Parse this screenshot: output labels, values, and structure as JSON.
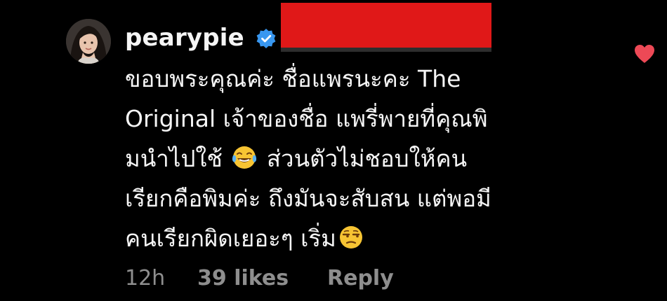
{
  "comment": {
    "username": "pearypie",
    "verified": true,
    "text_lines": [
      "ขอบพระคุณค่ะ ชื่อแพรนะคะ The",
      "Original เจ้าของชื่อ แพรี่พายที่คุณพิ",
      "มนำไปใช้",
      "ส่วนตัวไม่ชอบให้คน",
      "เรียกคือพิมค่ะ ถึงมันจะสับสน แต่พอมี",
      "คนเรียกผิดเยอะๆ เริ่ม"
    ],
    "emojis": [
      "laughing-tears-emoji",
      "unamused-emoji"
    ],
    "time": "12h",
    "likes": "39 likes",
    "reply_label": "Reply"
  },
  "colors": {
    "background": "#000000",
    "text": "#f5f5f5",
    "meta": "#8e8e8e",
    "verified_badge": "#3897f0",
    "heart": "#ed4956",
    "redaction": "#e01818"
  },
  "icons": {
    "verified": "verified-badge-icon",
    "like": "heart-icon"
  }
}
